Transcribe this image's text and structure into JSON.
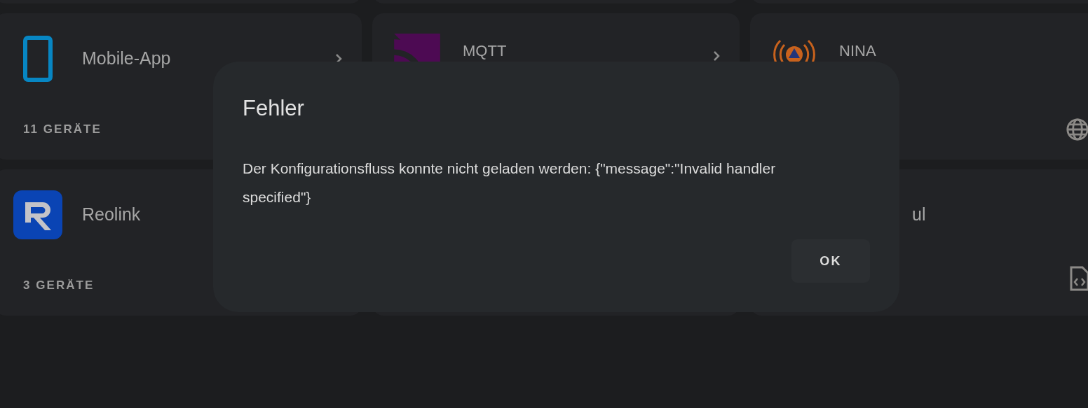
{
  "cards": [
    {
      "kind": "phone",
      "name": "Mobile-App",
      "devices": "11 GERÄTE"
    },
    {
      "kind": "mqtt",
      "name": "MQTT"
    },
    {
      "kind": "nina",
      "name": "NINA"
    },
    {
      "kind": "reolink",
      "name": "Reolink",
      "devices": "3 GERÄTE"
    },
    {
      "kind": "covered"
    },
    {
      "kind": "file",
      "name": "ul"
    }
  ],
  "dialog": {
    "title": "Fehler",
    "message": "Der Konfigurationsfluss konnte nicht geladen werden: {\"message\":\"Invalid handler specified\"}",
    "button": "OK"
  }
}
